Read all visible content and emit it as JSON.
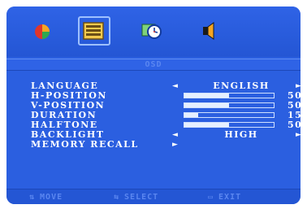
{
  "header": {
    "title": "OSD"
  },
  "tabs": [
    {
      "icon": "color-icon",
      "active": false
    },
    {
      "icon": "osd-icon",
      "active": true
    },
    {
      "icon": "clock-icon",
      "active": false
    },
    {
      "icon": "audio-icon",
      "active": false
    }
  ],
  "menu": {
    "language": {
      "label": "LANGUAGE",
      "value": "ENGLISH"
    },
    "h_position": {
      "label": "H-POSITION",
      "value": "50",
      "level": 50
    },
    "v_position": {
      "label": "V-POSITION",
      "value": "50",
      "level": 50
    },
    "duration": {
      "label": "DURATION",
      "value": "15",
      "level": 15
    },
    "halftone": {
      "label": "HALFTONE",
      "value": "50",
      "level": 50
    },
    "backlight": {
      "label": "BACKLIGHT",
      "value": "HIGH"
    },
    "memory_recall": {
      "label": "MEMORY RECALL"
    }
  },
  "footer": {
    "move": "MOVE",
    "select": "SELECT",
    "exit": "EXIT"
  },
  "colors": {
    "panel": "#2b5fe0",
    "text": "#ffffff",
    "dim_text": "#5a86f0"
  }
}
